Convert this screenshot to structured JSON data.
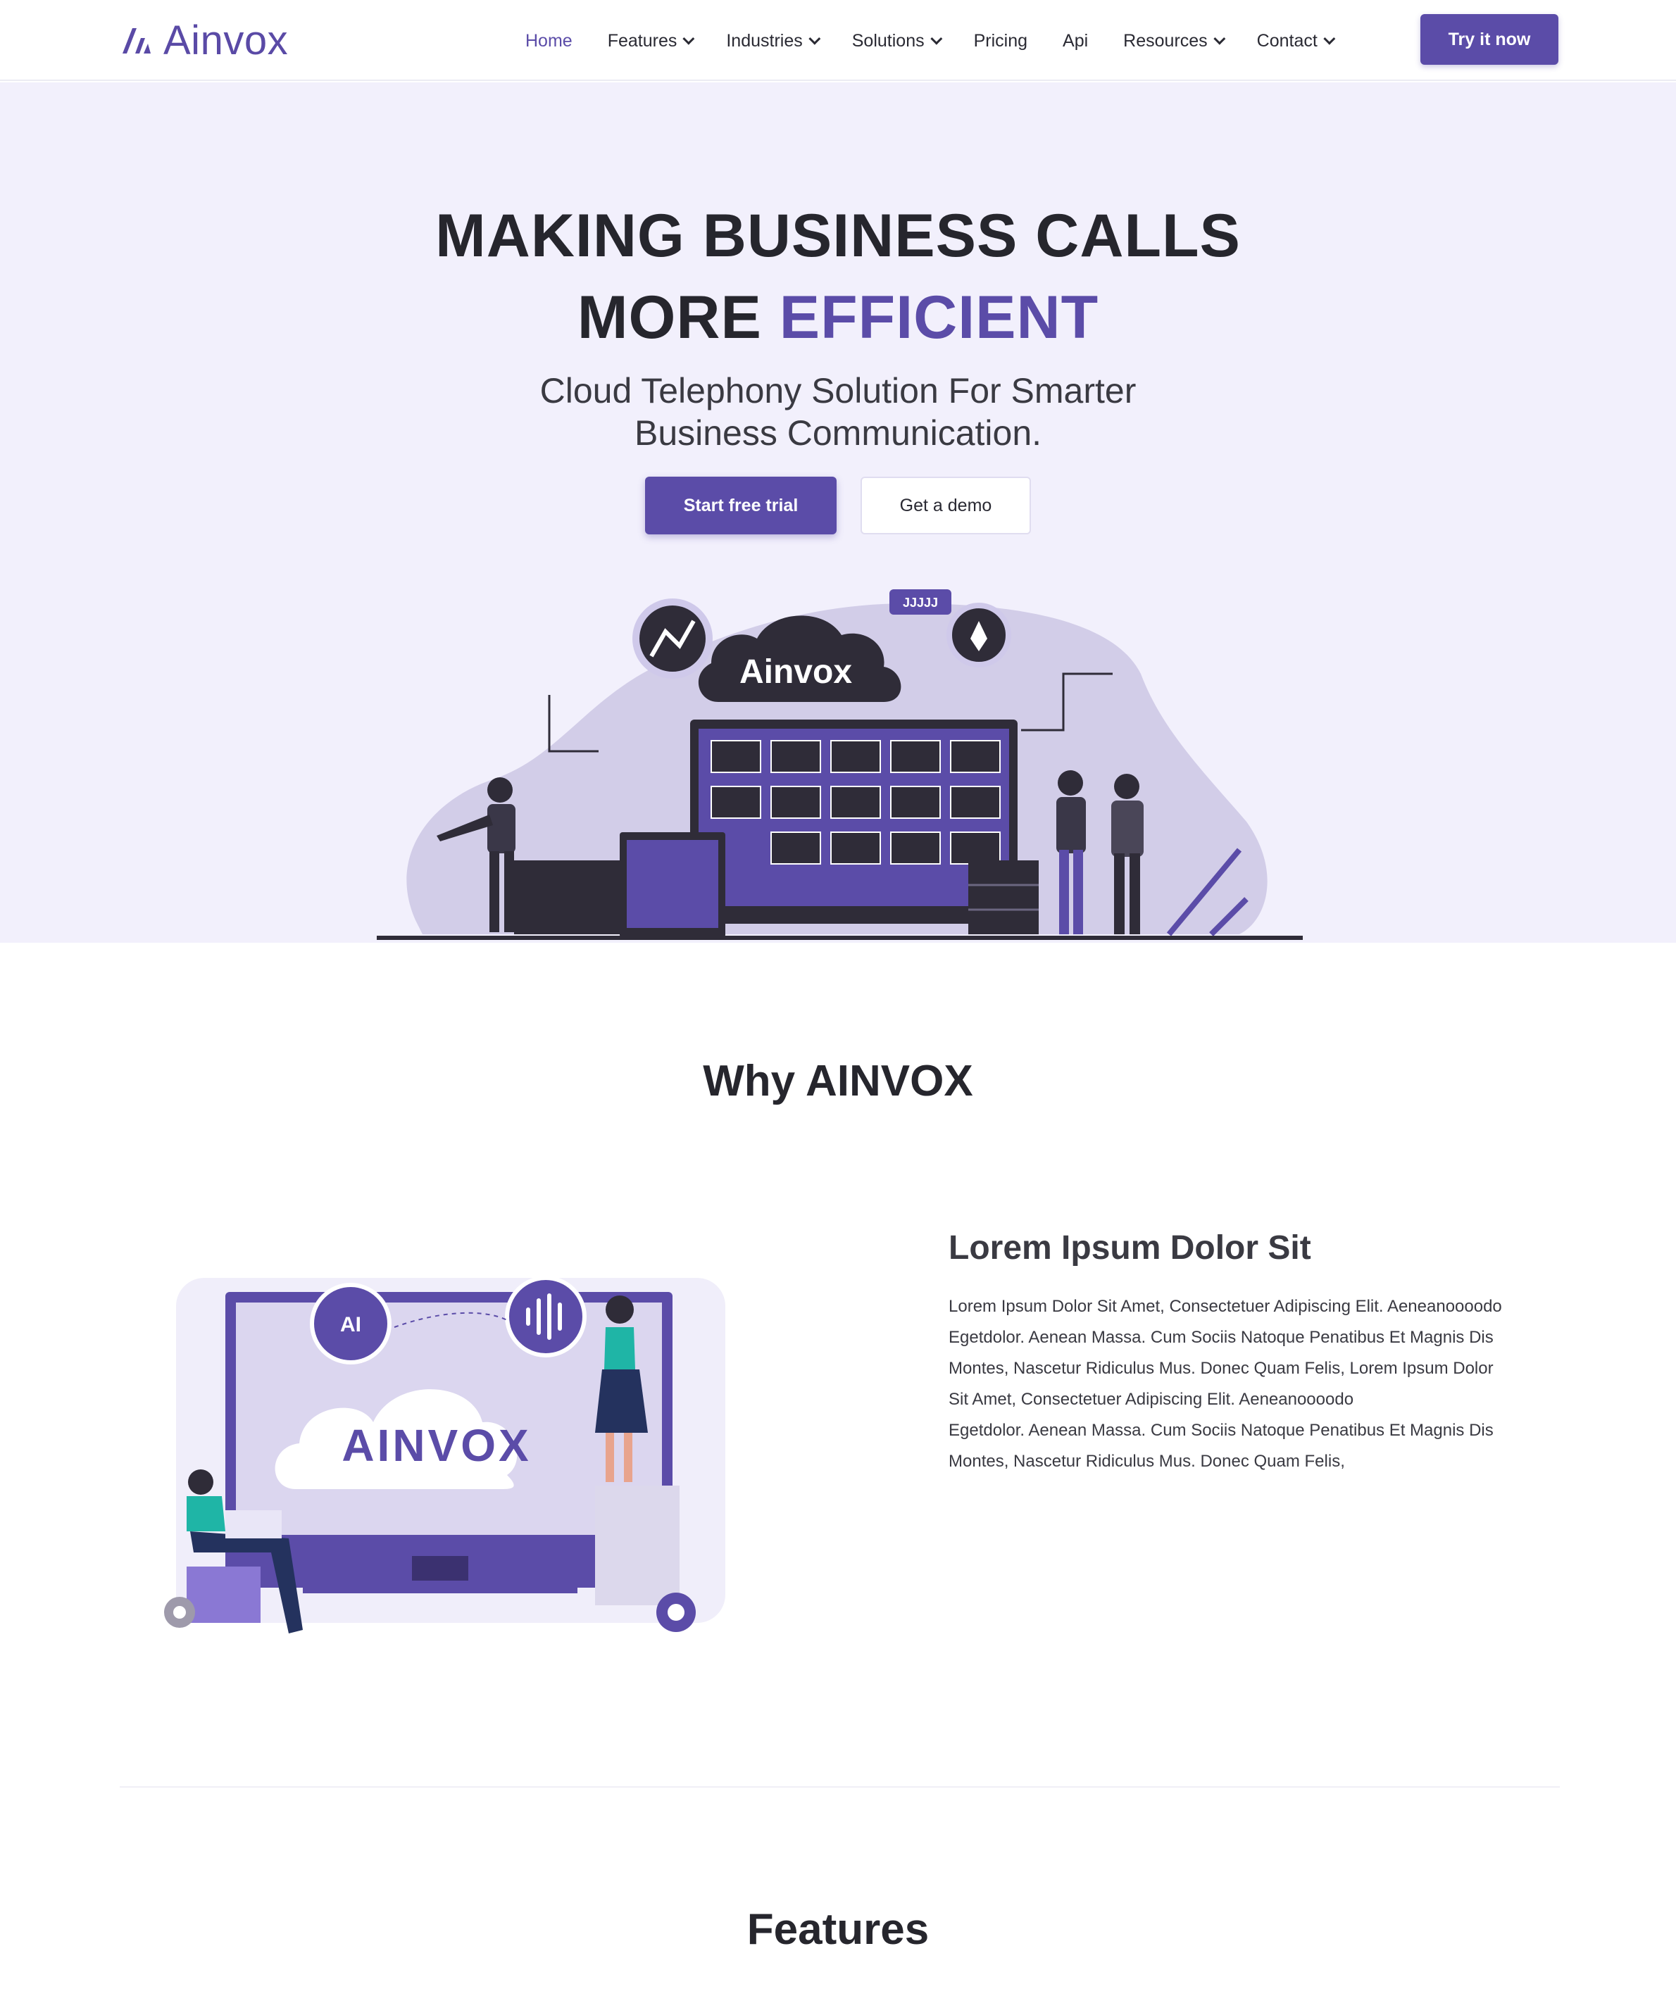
{
  "brand": {
    "name": "Ainvox",
    "accent": "#5b4ca8",
    "hero_bg": "#f2f0fc"
  },
  "nav": {
    "items": [
      {
        "label": "Home",
        "active": true,
        "dropdown": false
      },
      {
        "label": "Features",
        "active": false,
        "dropdown": true
      },
      {
        "label": "Industries",
        "active": false,
        "dropdown": true
      },
      {
        "label": "Solutions",
        "active": false,
        "dropdown": true
      },
      {
        "label": "Pricing",
        "active": false,
        "dropdown": false
      },
      {
        "label": "Api",
        "active": false,
        "dropdown": false
      },
      {
        "label": "Resources",
        "active": false,
        "dropdown": true
      },
      {
        "label": "Contact",
        "active": false,
        "dropdown": true
      }
    ],
    "cta_label": "Try it now"
  },
  "hero": {
    "title_line1": "MAKING BUSINESS CALLS",
    "title_line2_plain": "MORE ",
    "title_line2_accent": "EFFICIENT",
    "subtitle_line1": "Cloud Telephony Solution For Smarter",
    "subtitle_line2": "Business Communication.",
    "primary_button": "Start free trial",
    "secondary_button": "Get a demo",
    "illustration_cloud_label": "Ainvox",
    "illustration_badge": "JJJJJ"
  },
  "why": {
    "title": "Why AINVOX",
    "illustration_label": "AINVOX",
    "illustration_badge": "AI",
    "heading": "Lorem Ipsum Dolor Sit",
    "paragraph_lines": [
      "Lorem Ipsum Dolor Sit Amet, Consectetuer Adipiscing Elit. Aeneanoooodo",
      "Egetdolor. Aenean Massa. Cum Sociis Natoque Penatibus Et Magnis Dis",
      "Montes, Nascetur Ridiculus Mus. Donec Quam Felis, Lorem Ipsum Dolor",
      "Sit Amet, Consectetuer Adipiscing Elit. Aeneanoooodo",
      "Egetdolor. Aenean Massa. Cum Sociis Natoque Penatibus Et Magnis Dis",
      "Montes, Nascetur Ridiculus Mus. Donec Quam Felis,"
    ]
  },
  "features": {
    "title": "Features"
  }
}
